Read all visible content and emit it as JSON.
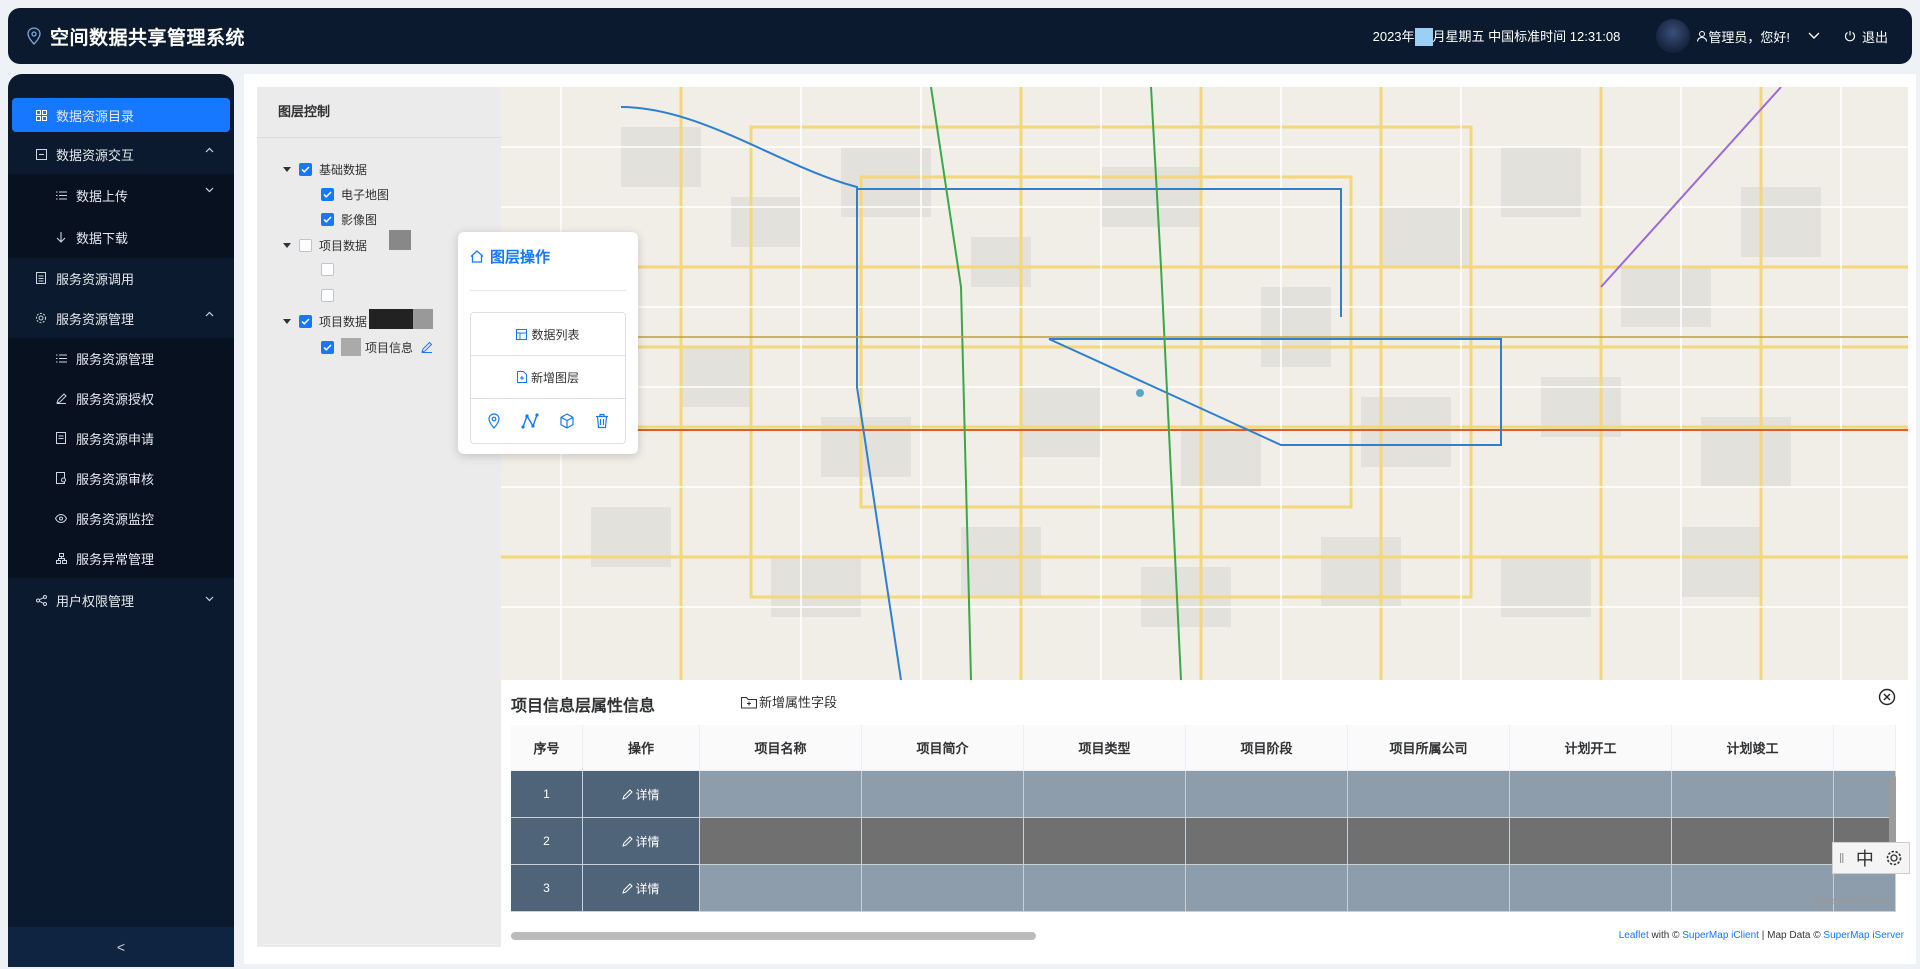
{
  "app": {
    "title": "空间数据共享管理系统"
  },
  "header": {
    "datetime_prefix": "2023年",
    "datetime_suffix": "月星期五 中国标准时间 12:31:08",
    "greeting": "管理员，您好!",
    "logout_label": "退出"
  },
  "sidebar": {
    "items": [
      {
        "label": "数据资源目录",
        "icon": "grid-icon",
        "active": true
      },
      {
        "label": "数据资源交互",
        "icon": "box-icon",
        "expanded": true
      },
      {
        "label": "数据上传",
        "icon": "list-icon",
        "sub": true,
        "expandable": true
      },
      {
        "label": "数据下载",
        "icon": "arrow-down-icon",
        "sub": true
      },
      {
        "label": "服务资源调用",
        "icon": "doc-icon"
      },
      {
        "label": "服务资源管理",
        "icon": "gear-icon",
        "expanded": true
      },
      {
        "label": "服务资源管理",
        "icon": "list-icon",
        "sub": true
      },
      {
        "label": "服务资源授权",
        "icon": "edit-icon",
        "sub": true
      },
      {
        "label": "服务资源申请",
        "icon": "doc-icon",
        "sub": true
      },
      {
        "label": "服务资源审核",
        "icon": "audit-icon",
        "sub": true
      },
      {
        "label": "服务资源监控",
        "icon": "eye-icon",
        "sub": true
      },
      {
        "label": "服务异常管理",
        "icon": "network-icon",
        "sub": true
      },
      {
        "label": "用户权限管理",
        "icon": "share-icon",
        "expandable": true
      }
    ],
    "collapse_glyph": "<"
  },
  "layer_control": {
    "title": "图层控制",
    "nodes": [
      {
        "label": "基础数据",
        "checked": true
      },
      {
        "label": "电子地图",
        "checked": true
      },
      {
        "label": "影像图",
        "checked": true
      },
      {
        "label": "项目数据",
        "checked": false
      },
      {
        "label": "项目数据",
        "checked": true
      },
      {
        "label": "项目信息",
        "checked": true
      }
    ]
  },
  "popup": {
    "title": "图层操作",
    "btn_data_list": "数据列表",
    "btn_new_layer": "新增图层"
  },
  "attr_panel": {
    "title": "项目信息层属性信息",
    "add_field_label": "新增属性字段",
    "columns": [
      "序号",
      "操作",
      "项目名称",
      "项目简介",
      "项目类型",
      "项目阶段",
      "项目所属公司",
      "计划开工",
      "计划竣工"
    ],
    "rows": [
      {
        "idx": "1",
        "op": "详情"
      },
      {
        "idx": "2",
        "op": "详情"
      },
      {
        "idx": "3",
        "op": "详情"
      }
    ]
  },
  "map_controls": {
    "lang": "中"
  },
  "attribution": {
    "leaflet": "Leaflet",
    "with": " with © ",
    "iclient": "SuperMap iClient",
    "mapdata": " | Map Data © ",
    "iserver": "SuperMap iServer"
  },
  "watermark": "SuperMap iClient"
}
